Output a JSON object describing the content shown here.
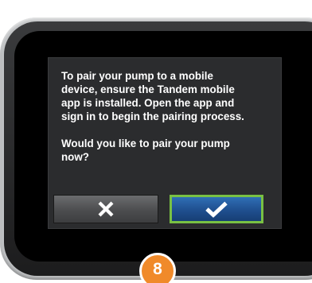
{
  "dialog": {
    "message": "To pair your pump to a mobile\ndevice, ensure the Tandem mobile\napp is installed. Open the app and\nsign in to begin the pairing process.\n\nWould you like to pair your pump\nnow?",
    "cancel_icon": "close-x-icon",
    "confirm_icon": "checkmark-icon"
  },
  "step_badge": {
    "number": "8"
  },
  "colors": {
    "confirm_button": "#1f4f8f",
    "confirm_border": "#79c143",
    "cancel_button": "#4c4d4f",
    "badge": "#f08a2a",
    "screen": "#000000"
  }
}
